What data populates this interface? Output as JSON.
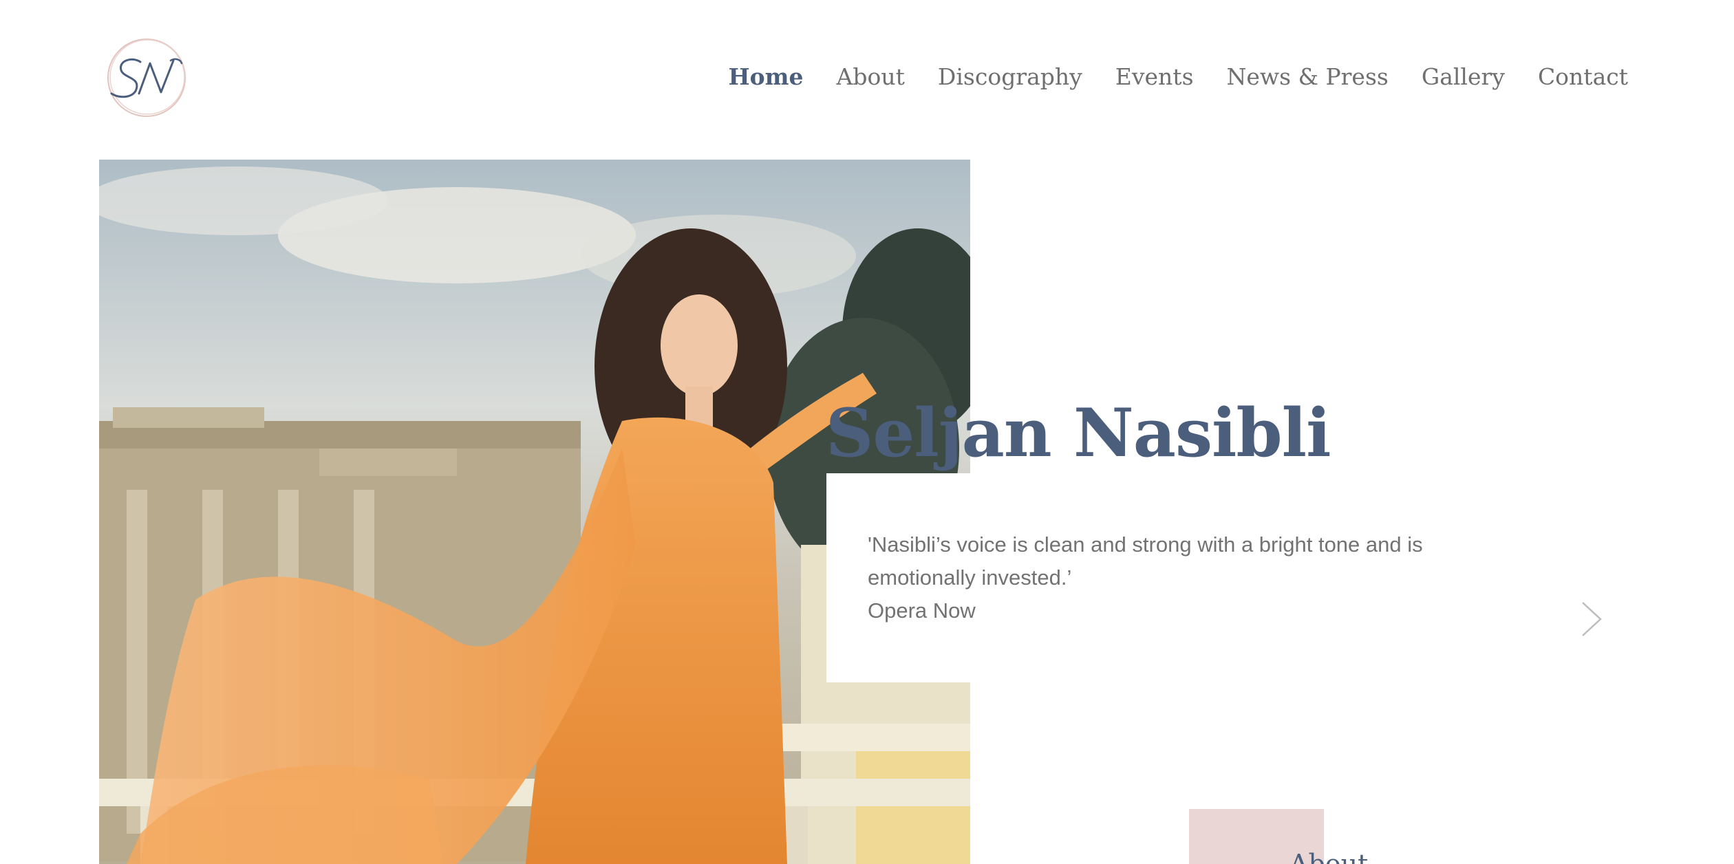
{
  "logo": {
    "monogram": "SN",
    "icon": "sn-monogram-logo",
    "ring_color": "#e2c3bd",
    "ink_color": "#4b5e7c"
  },
  "nav": {
    "items": [
      {
        "label": "Home",
        "active": true
      },
      {
        "label": "About",
        "active": false
      },
      {
        "label": "Discography",
        "active": false
      },
      {
        "label": "Events",
        "active": false
      },
      {
        "label": "News & Press",
        "active": false
      },
      {
        "label": "Gallery",
        "active": false
      },
      {
        "label": "Contact",
        "active": false
      }
    ]
  },
  "hero": {
    "name": "Seljan Nasibli",
    "quote": "'Nasibli’s voice is clean and strong with a bright tone and is emotionally invested.’",
    "quote_source": "Opera Now",
    "next_icon": "chevron-right-icon"
  },
  "about": {
    "heading": "About",
    "accent_color": "#ead6d4"
  },
  "colors": {
    "brand": "#4b5e7c",
    "text": "#727272",
    "dress": "#ef9a45"
  }
}
